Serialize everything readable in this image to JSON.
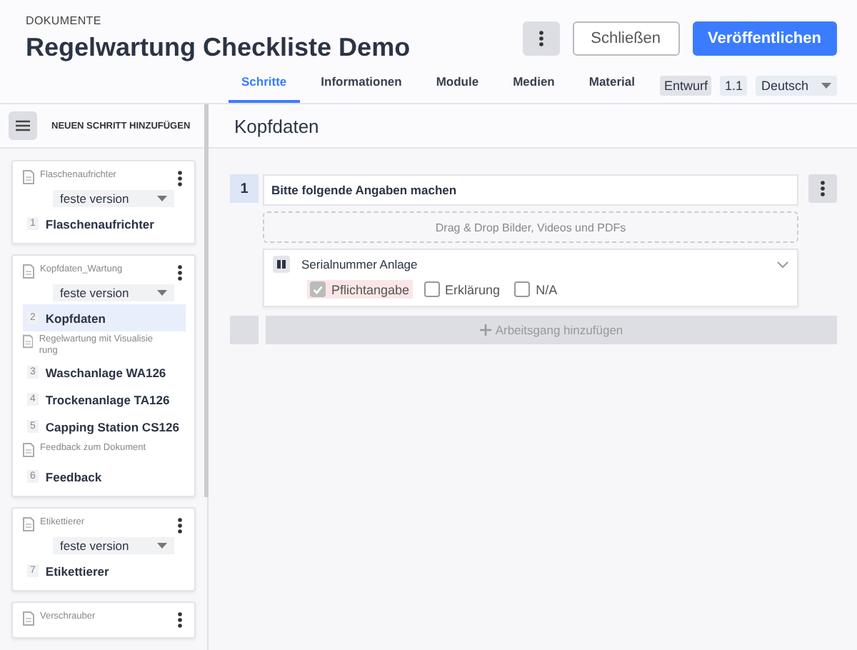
{
  "header": {
    "breadcrumb": "DOKUMENTE",
    "title": "Regelwartung Checkliste Demo",
    "close_button": "Schließen",
    "publish_button": "Veröffentlichen"
  },
  "tabs": [
    {
      "label": "Schritte",
      "selected": true
    },
    {
      "label": "Informationen",
      "selected": false
    },
    {
      "label": "Module",
      "selected": false
    },
    {
      "label": "Medien",
      "selected": false
    },
    {
      "label": "Material",
      "selected": false
    }
  ],
  "status": {
    "state": "Entwurf",
    "version": "1.1",
    "language": "Deutsch"
  },
  "sidebar": {
    "add_step": "NEUEN SCHRITT HINZUFÜGEN",
    "cards": [
      {
        "items": [
          {
            "kind": "document",
            "label": "Flaschenaufrichter"
          },
          {
            "kind": "version",
            "label": "feste version"
          },
          {
            "kind": "step",
            "number": "1",
            "label": "Flaschenaufrichter",
            "selected": false
          }
        ]
      },
      {
        "items": [
          {
            "kind": "document",
            "label": "Kopfdaten_Wartung"
          },
          {
            "kind": "version",
            "label": "feste version"
          },
          {
            "kind": "step",
            "number": "2",
            "label": "Kopfdaten",
            "selected": true
          },
          {
            "kind": "document",
            "label": "Regelwartung mit Visualisie rung"
          },
          {
            "kind": "step",
            "number": "3",
            "label": "Waschanlage WA126",
            "selected": false
          },
          {
            "kind": "step",
            "number": "4",
            "label": "Trockenanlage TA126",
            "selected": false
          },
          {
            "kind": "step",
            "number": "5",
            "label": "Capping Station CS126",
            "selected": false
          },
          {
            "kind": "document",
            "label": "Feedback zum Dokument"
          },
          {
            "kind": "step",
            "number": "6",
            "label": "Feedback",
            "selected": false
          }
        ]
      },
      {
        "items": [
          {
            "kind": "document",
            "label": "Etikettierer"
          },
          {
            "kind": "version",
            "label": "feste version"
          },
          {
            "kind": "step",
            "number": "7",
            "label": "Etikettierer",
            "selected": false
          }
        ]
      },
      {
        "items": [
          {
            "kind": "document",
            "label": "Verschrauber"
          }
        ]
      }
    ]
  },
  "main": {
    "title": "Kopfdaten",
    "operations": [
      {
        "number": "1",
        "title": "Bitte folgende Angaben machen",
        "dropzone": "Drag & Drop Bilder, Videos und PDFs",
        "fields": [
          {
            "label": "Serialnummer Anlage",
            "options": [
              {
                "label": "Pflichtangabe",
                "checked": true
              },
              {
                "label": "Erklärung",
                "checked": false
              },
              {
                "label": "N/A",
                "checked": false
              }
            ]
          }
        ]
      }
    ],
    "add_operation": "Arbeitsgang hinzufügen"
  }
}
